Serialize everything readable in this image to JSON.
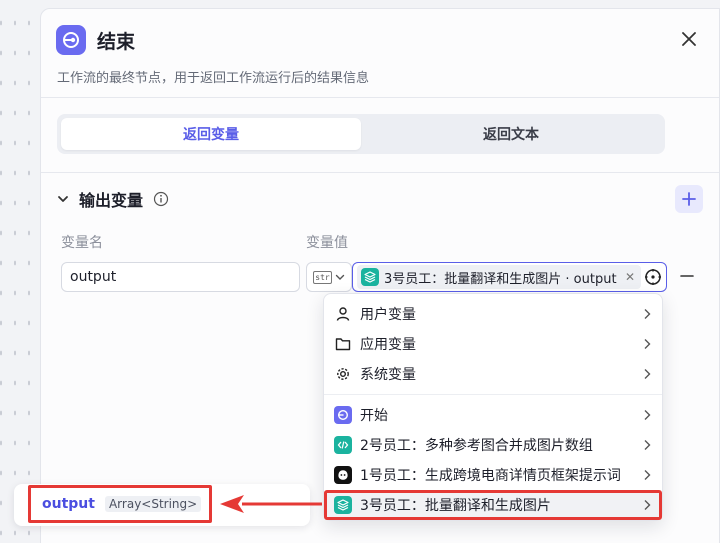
{
  "header": {
    "title": "结束",
    "description": "工作流的最终节点，用于返回工作流运行后的结果信息"
  },
  "tabs": [
    {
      "label": "返回变量",
      "active": true
    },
    {
      "label": "返回文本",
      "active": false
    }
  ],
  "output_section": {
    "title": "输出变量",
    "col_name": "变量名",
    "col_value": "变量值",
    "row": {
      "name": "output",
      "type_icon": "str",
      "value_tag": "3号员工：批量翻译和生成图片 · output"
    }
  },
  "dropdown": {
    "groups": [
      [
        {
          "icon": "user-icon",
          "label": "用户变量"
        },
        {
          "icon": "folder-icon",
          "label": "应用变量"
        },
        {
          "icon": "gear-icon",
          "label": "系统变量"
        }
      ],
      [
        {
          "icon": "start-icon",
          "label": "开始",
          "color": "#6a6bf0"
        },
        {
          "icon": "code-icon",
          "label": "2号员工：多种参考图合并成图片数组",
          "color": "#1bb39f"
        },
        {
          "icon": "bot-icon",
          "label": "1号员工：生成跨境电商详情页框架提示词",
          "color": "#111111"
        },
        {
          "icon": "layers-icon",
          "label": "3号员工：批量翻译和生成图片",
          "color": "#1bb39f",
          "highlighted": true
        }
      ]
    ]
  },
  "output_chip": {
    "name": "output",
    "type": "Array<String>"
  },
  "colors": {
    "accent": "#5a5ee8",
    "annotation_red": "#e53935"
  }
}
